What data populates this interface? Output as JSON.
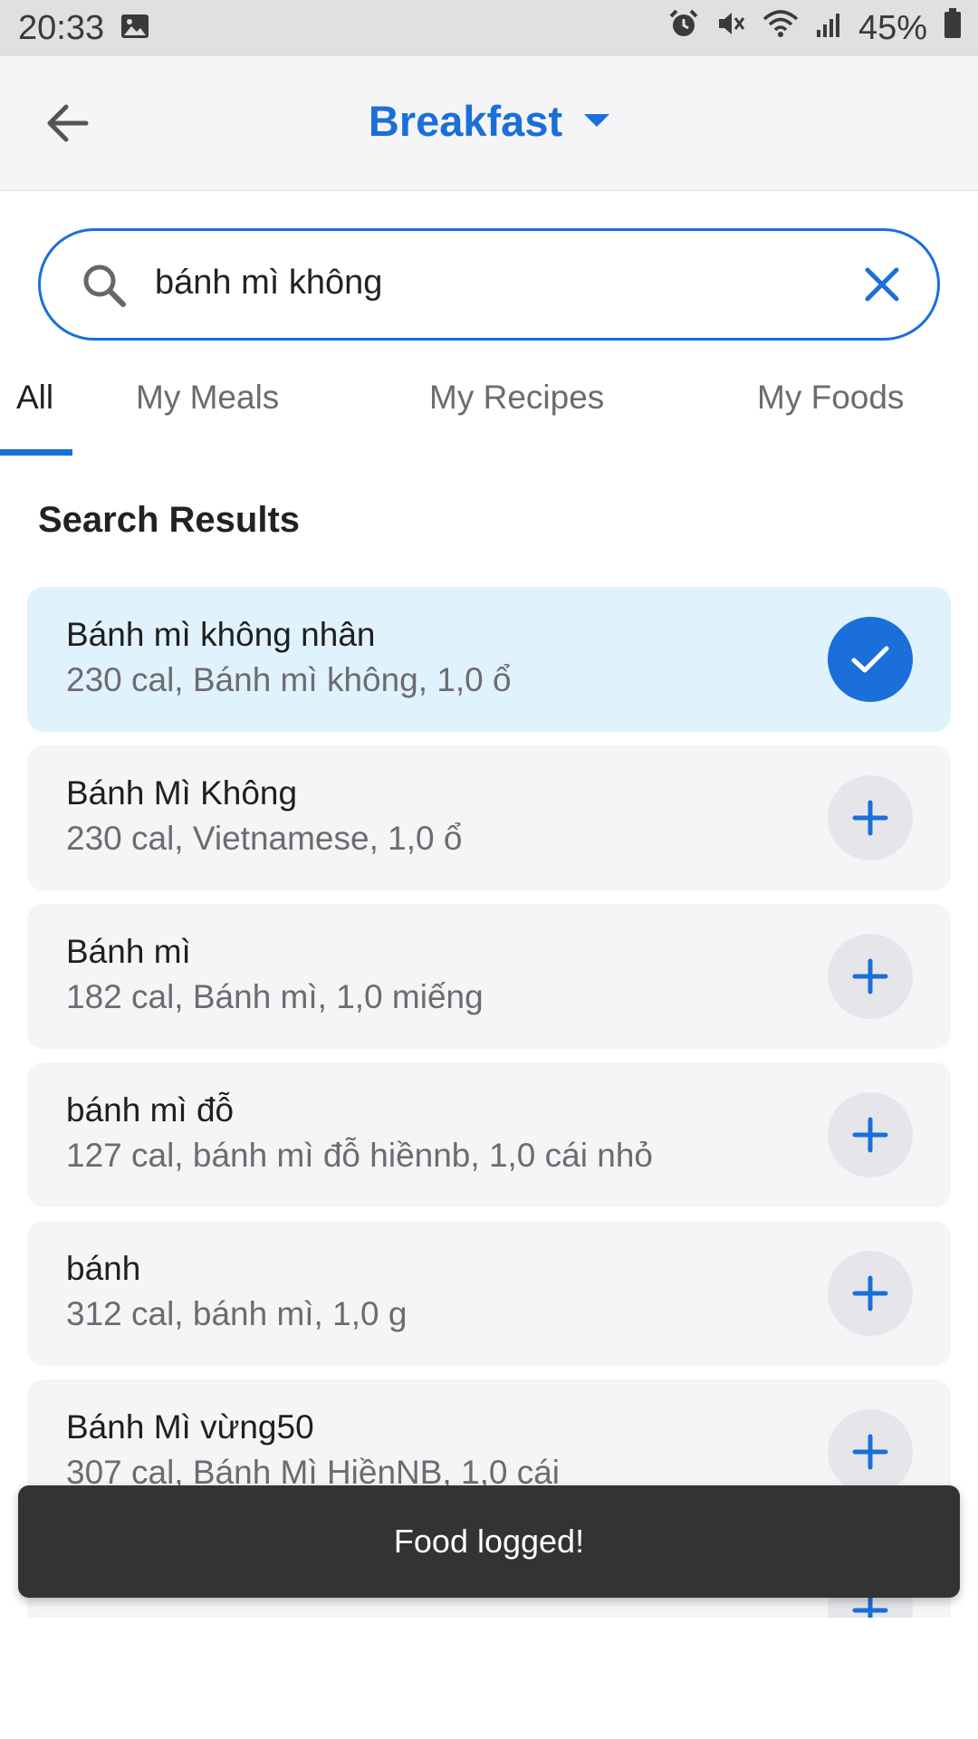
{
  "status_bar": {
    "time": "20:33",
    "battery": "45%",
    "icons": [
      "image-icon",
      "alarm-icon",
      "mute-icon",
      "wifi-icon",
      "signal-icon",
      "battery-icon"
    ]
  },
  "header": {
    "title": "Breakfast"
  },
  "search": {
    "value": "bánh mì không"
  },
  "tabs": [
    {
      "label": "All"
    },
    {
      "label": "My Meals"
    },
    {
      "label": "My Recipes"
    },
    {
      "label": "My Foods"
    }
  ],
  "section_title": "Search Results",
  "results": [
    {
      "name": "Bánh mì không nhân",
      "detail": "230 cal, Bánh mì không, 1,0 ổ",
      "selected": true
    },
    {
      "name": "Bánh Mì Không",
      "detail": "230 cal, Vietnamese, 1,0 ổ",
      "selected": false
    },
    {
      "name": "Bánh mì",
      "detail": "182 cal, Bánh mì, 1,0 miếng",
      "selected": false
    },
    {
      "name": "bánh mì đỗ",
      "detail": "127 cal, bánh mì đỗ hiềnnb, 1,0 cái nhỏ",
      "selected": false
    },
    {
      "name": "bánh",
      "detail": "312 cal, bánh mì, 1,0 g",
      "selected": false
    },
    {
      "name": "Bánh Mì vừng50",
      "detail": "307 cal, Bánh Mì HiềnNB, 1,0 cái",
      "selected": false
    }
  ],
  "snackbar": {
    "message": "Food logged!"
  },
  "colors": {
    "accent": "#1a6fd8",
    "selected_bg": "#e0f2fc",
    "card_bg": "#f5f5f7",
    "snackbar_bg": "#333333"
  }
}
